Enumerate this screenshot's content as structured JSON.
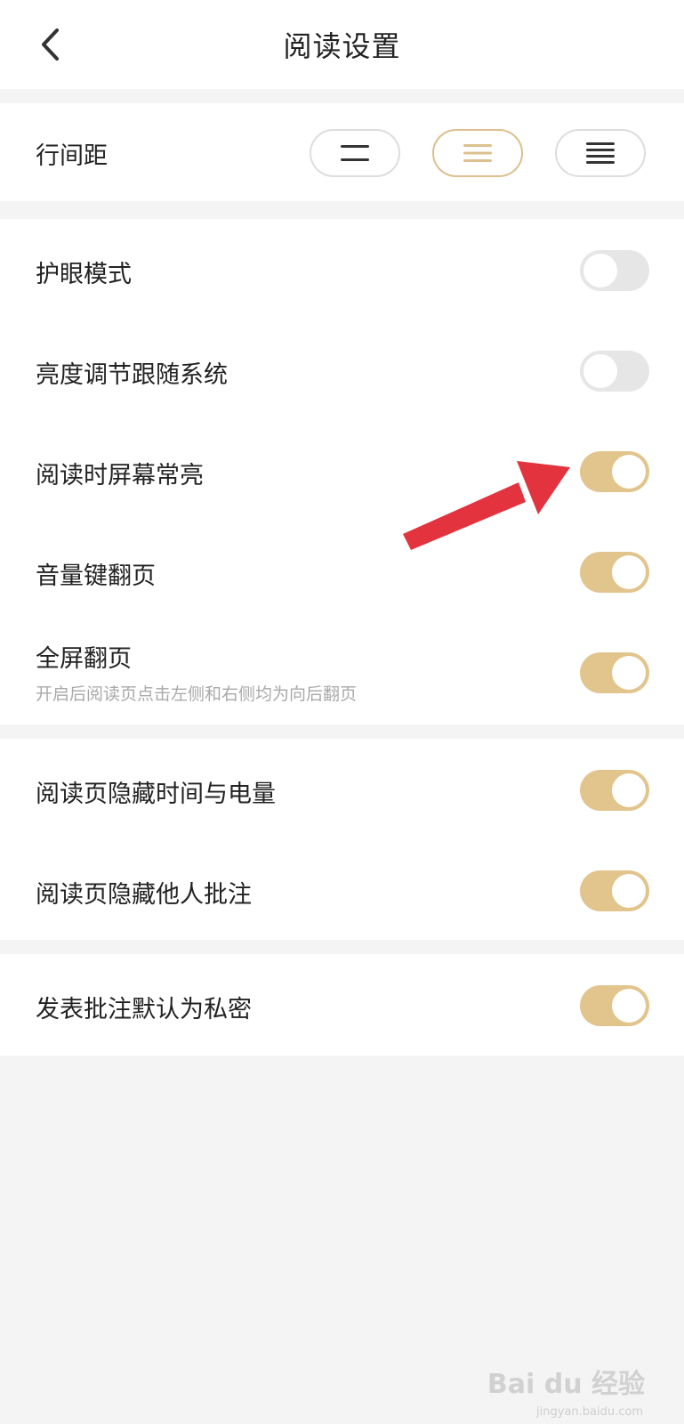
{
  "header": {
    "title": "阅读设置",
    "back_icon": "chevron-left-icon"
  },
  "line_spacing": {
    "label": "行间距",
    "options": [
      {
        "icon": "line-spacing-loose-icon",
        "selected": false
      },
      {
        "icon": "line-spacing-medium-icon",
        "selected": true
      },
      {
        "icon": "line-spacing-tight-icon",
        "selected": false
      }
    ]
  },
  "settings": {
    "eye_protection": {
      "label": "护眼模式",
      "enabled": false
    },
    "brightness_follow_system": {
      "label": "亮度调节跟随系统",
      "enabled": false
    },
    "screen_always_on": {
      "label": "阅读时屏幕常亮",
      "enabled": true
    },
    "volume_key_page_turn": {
      "label": "音量键翻页",
      "enabled": true
    },
    "fullscreen_page_turn": {
      "label": "全屏翻页",
      "description": "开启后阅读页点击左侧和右侧均为向后翻页",
      "enabled": true
    },
    "hide_time_battery": {
      "label": "阅读页隐藏时间与电量",
      "enabled": true
    },
    "hide_others_notes": {
      "label": "阅读页隐藏他人批注",
      "enabled": true
    },
    "private_notes_default": {
      "label": "发表批注默认为私密",
      "enabled": true
    }
  },
  "annotation": {
    "icon": "red-arrow-icon"
  },
  "watermark": {
    "text": "Bai du 经验",
    "subtext": "jingyan.baidu.com"
  },
  "colors": {
    "accent": "#e2c48d",
    "toggle_off": "#e6e6e6",
    "background": "#f4f4f4",
    "arrow": "#e2333f"
  }
}
